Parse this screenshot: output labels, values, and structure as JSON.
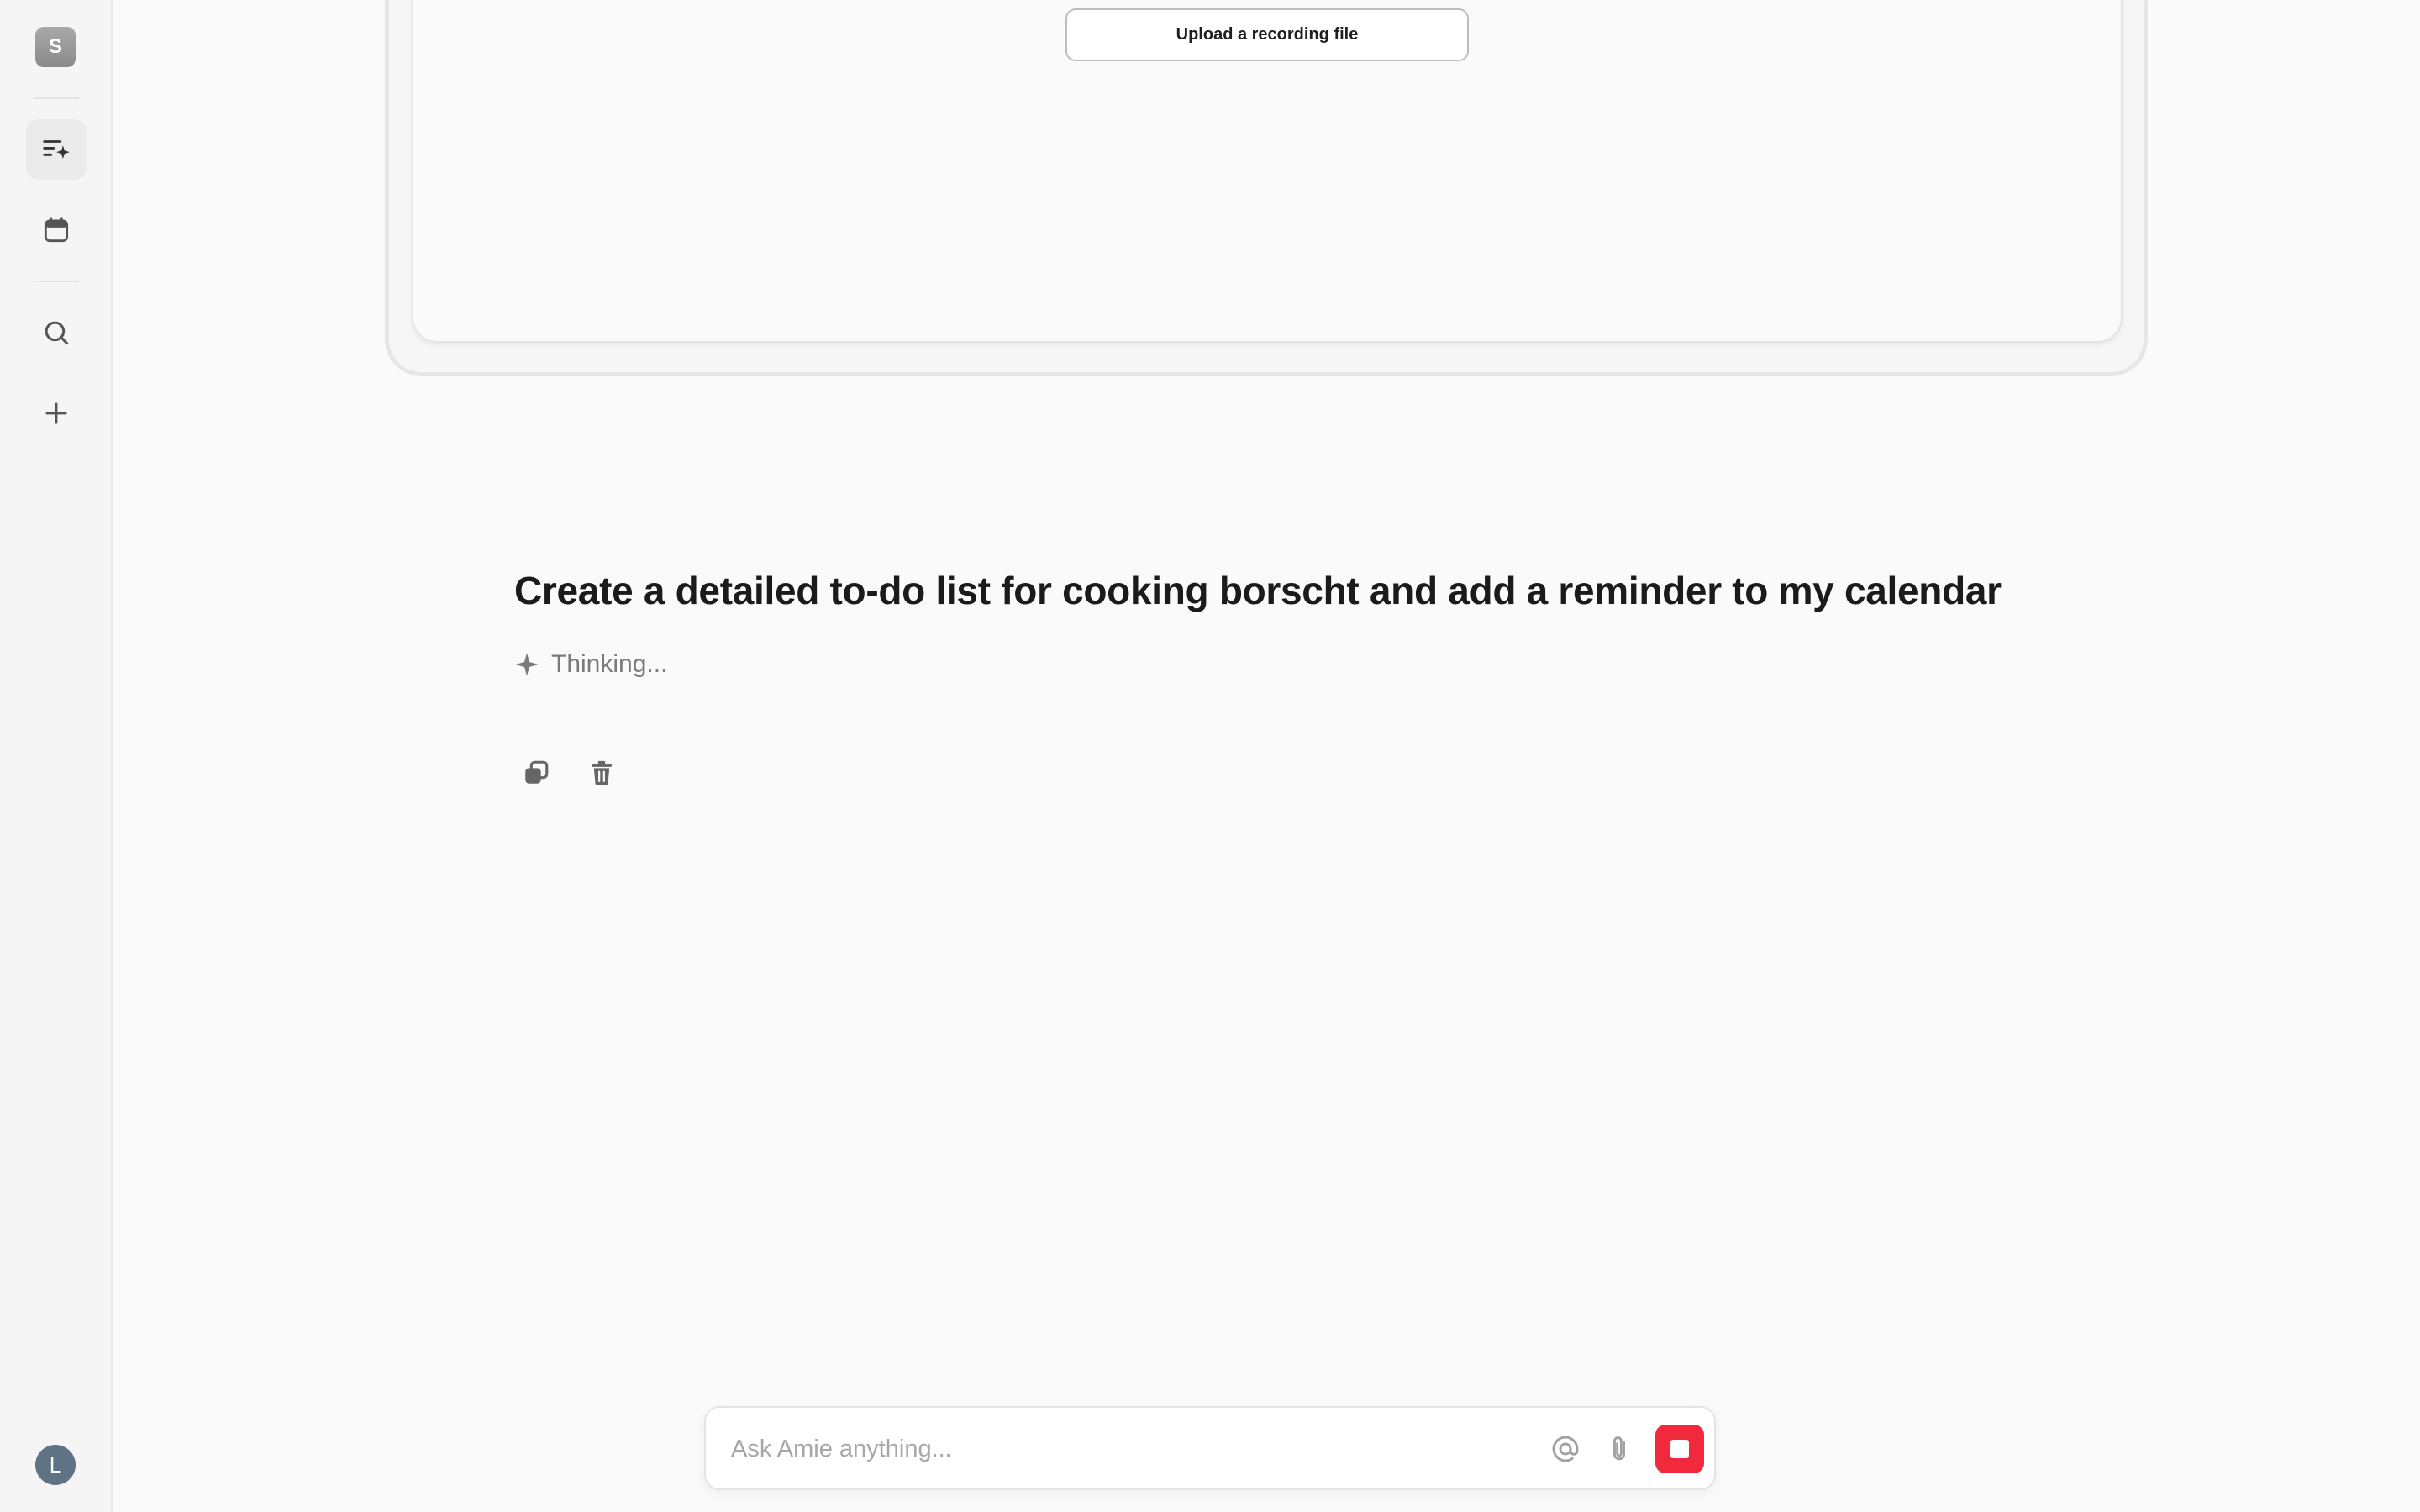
{
  "sidebar": {
    "workspace_initial": "S",
    "items": [
      {
        "name": "ai-tasks",
        "icon": "sparkle-list-icon",
        "active": true
      },
      {
        "name": "calendar",
        "icon": "calendar-icon",
        "active": false
      },
      {
        "name": "search",
        "icon": "search-icon",
        "active": false
      },
      {
        "name": "new",
        "icon": "plus-icon",
        "active": false
      }
    ],
    "user_initial": "L"
  },
  "recording_card": {
    "upload_label": "Upload a recording file"
  },
  "conversation": {
    "prompt": "Create a detailed to-do list for cooking borscht and add a reminder to my calendar",
    "status": "Thinking..."
  },
  "composer": {
    "placeholder": "Ask Amie anything...",
    "stop_color": "#f2283c"
  }
}
